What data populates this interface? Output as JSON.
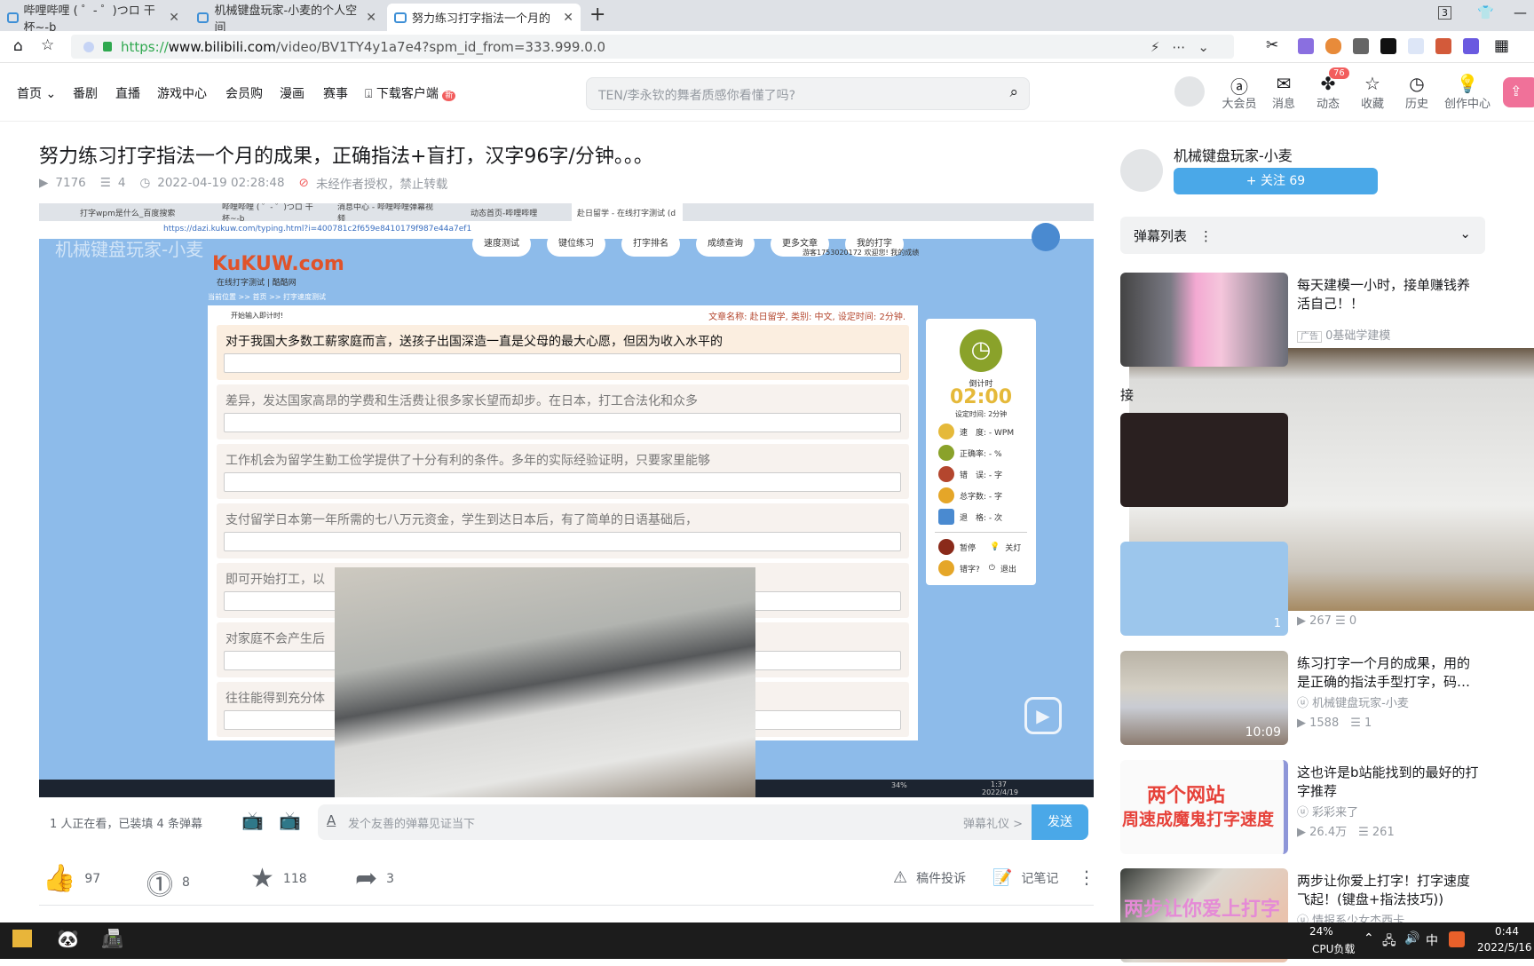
{
  "browser": {
    "tabs": [
      {
        "label": "哔哩哔哩 ( ゜- ゜)つロ 干杯~-b"
      },
      {
        "label": "机械键盘玩家-小麦的个人空间"
      },
      {
        "label": "努力练习打字指法一个月的"
      }
    ],
    "new_tab": "+",
    "tab_count": "3",
    "url_scheme": "https://",
    "url_host": "www.bilibili.com",
    "url_path": "/video/BV1TY4y1a7e4?spm_id_from=333.999.0.0"
  },
  "nav": {
    "items": [
      "首页 ⌄",
      "番剧",
      "直播",
      "游戏中心",
      "会员购",
      "漫画",
      "赛事",
      "下载客户端"
    ],
    "new_badge": "新",
    "search_placeholder": "TEN/李永钦的舞者质感你看懂了吗?",
    "right": [
      {
        "label": "大会员",
        "icon": "vip-icon"
      },
      {
        "label": "消息",
        "icon": "mail-icon"
      },
      {
        "label": "动态",
        "icon": "pinwheel-icon",
        "badge": "76"
      },
      {
        "label": "收藏",
        "icon": "star-icon"
      },
      {
        "label": "历史",
        "icon": "clock-icon"
      },
      {
        "label": "创作中心",
        "icon": "bulb-icon"
      }
    ]
  },
  "video": {
    "title": "努力练习打字指法一个月的成果，正确指法+盲打，汉字96字/分钟。。。",
    "views": "7176",
    "danmaku": "4",
    "date": "2022-04-19 02:28:48",
    "notice": "未经作者授权，禁止转载"
  },
  "inner": {
    "tabs": [
      "打字wpm是什么_百度搜索",
      "哔哩哔哩 ( ゜- ゜)つロ 干杯~-b",
      "消息中心 - 哔哩哔哩弹幕视频",
      "动态首页-哔哩哔哩",
      "赴日留学 - 在线打字测试 (d"
    ],
    "url": "https://dazi.kukuw.com/typing.html?i=400781c2f659e8410179f987e44a7ef1",
    "watermark": "机械键盘玩家-小麦",
    "logo": "KuKUW.com",
    "logo_sub": "在线打字测试 | 酷酷网",
    "menu": [
      "速度测试",
      "键位练习",
      "打字排名",
      "成绩查询",
      "更多文章",
      "我的打字"
    ],
    "welcome": "游客1753020172 欢迎您!  我的成绩",
    "breadcrumb": "当前位置 >> 首页 >> 打字速度测试",
    "start_hint": "开始输入即计时!",
    "article_info": "文章名称: 赴日留学, 类别: 中文, 设定时间: 2分钟.",
    "lines": [
      "对于我国大多数工薪家庭而言，送孩子出国深造一直是父母的最大心愿，但因为收入水平的",
      "差异，发达国家高昂的学费和生活费让很多家长望而却步。在日本，打工合法化和众多",
      "工作机会为留学生勤工俭学提供了十分有利的条件。多年的实际经验证明，只要家里能够",
      "支付留学日本第一年所需的七八万元资金，学生到达日本后，有了简单的日语基础后，",
      "即可开始打工，以",
      "对家庭不会产生后",
      "往往能得到充分体"
    ],
    "timer": {
      "label": "倒计时",
      "value": "02:00",
      "set": "设定时间: 2分钟",
      "stats": [
        {
          "label": "速　度: - WPM",
          "color": "#e5b93a"
        },
        {
          "label": "正确率: - %",
          "color": "#8aa22a"
        },
        {
          "label": "错　误: - 字",
          "color": "#b4462e"
        },
        {
          "label": "总字数: - 字",
          "color": "#e5a628"
        },
        {
          "label": "退　格: - 次",
          "color": "#4a8ad0"
        }
      ],
      "buttons": [
        "暂停",
        "关灯",
        "错字?",
        "退出"
      ]
    },
    "clock": "1:37",
    "clock_date": "2022/4/19",
    "cpu": "34%"
  },
  "danmaku_bar": {
    "watching": "1 人正在看，已装填 4 条弹幕",
    "placeholder": "发个友善的弹幕见证当下",
    "etiquette": "弹幕礼仪 >",
    "send": "发送"
  },
  "actions": {
    "like": "97",
    "coin": "8",
    "favorite": "118",
    "share": "3",
    "report": "稿件投诉",
    "note": "记笔记"
  },
  "uploader": {
    "name": "机械键盘玩家-小麦",
    "follow": "+ 关注 69"
  },
  "danmaku_list": {
    "label": "弹幕列表"
  },
  "recommendations": [
    {
      "title": "每天建模一小时，接单赚钱养活自己！！",
      "tag": "广告",
      "author": "0基础学建模"
    },
    {
      "title": "接",
      "author": "",
      "views": "",
      "comments": ""
    },
    {
      "title": "",
      "views": "267",
      "comments": "0",
      "duration": "1"
    },
    {
      "title": "练习打字一个月的成果，用的是正确的指法手型打字，码…",
      "author": "机械键盘玩家-小麦",
      "views": "1588",
      "comments": "1",
      "duration": "10:09"
    },
    {
      "title": "这也许是b站能找到的最好的打字推荐",
      "author": "彩彩来了",
      "views": "26.4万",
      "comments": "261",
      "thumb_text1": "两个网站",
      "thumb_text2": "周速成魔鬼打字速度"
    },
    {
      "title": "两步让你爱上打字！打字速度飞起！(键盘+指法技巧))",
      "author": "情报系少女杰西卡",
      "thumb_text1": "两步让你爱上打字"
    }
  ],
  "taskbar": {
    "cpu": "24%",
    "cpu_label": "CPU负载",
    "ime": "中",
    "time": "0:44",
    "date": "2022/5/16"
  },
  "colors": {
    "accent": "#00aeec",
    "follow": "#4aa8e8",
    "pink": "#f07199",
    "badge": "#f25d5d"
  }
}
